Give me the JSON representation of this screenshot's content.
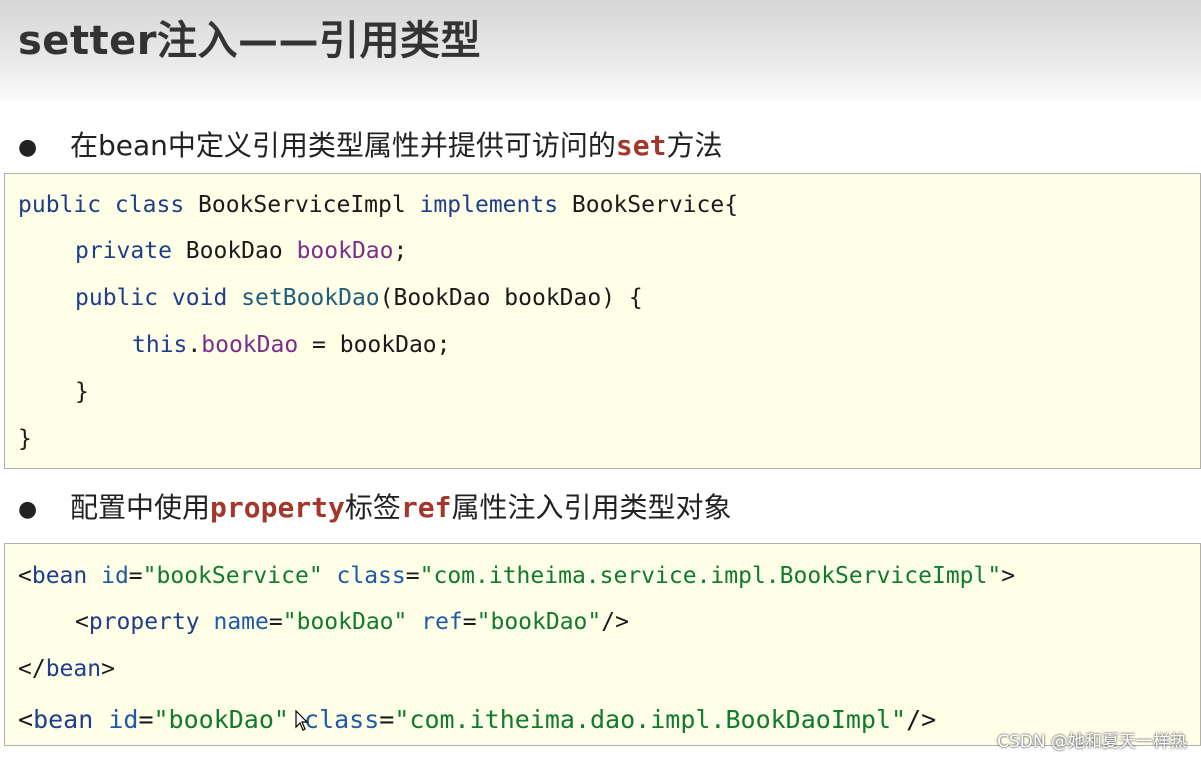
{
  "title": "setter注入——引用类型",
  "bullet1": {
    "prefix": "在bean中定义引用类型属性并提供可访问的",
    "keyword": "set",
    "suffix": "方法"
  },
  "java_code": {
    "line1": {
      "kw1": "public class",
      "t1": " BookServiceImpl ",
      "kw2": "implements",
      "t2": " BookService{"
    },
    "line2": {
      "kw": "private",
      "t1": " BookDao ",
      "field": "bookDao",
      "t2": ";"
    },
    "line3": {
      "kw": "public void",
      "method": "setBookDao",
      "t1": "(BookDao bookDao) {"
    },
    "line4": {
      "kw": "this",
      "t1": ".",
      "field": "bookDao",
      "t2": " = bookDao;"
    },
    "line5": "}",
    "line6": "}"
  },
  "bullet2": {
    "prefix": "配置中使用",
    "keyword1": "property",
    "middle": "标签",
    "keyword2": "ref",
    "suffix": "属性注入引用类型对象"
  },
  "xml_code": {
    "line1": {
      "open": "<",
      "tag": "bean",
      "a1": " id",
      "eq1": "=",
      "v1": "\"bookService\"",
      "a2": " class",
      "eq2": "=",
      "v2": "\"com.itheima.service.impl.BookServiceImpl\"",
      "close": ">"
    },
    "line2": {
      "open": "<",
      "tag": "property",
      "a1": " name",
      "eq1": "=",
      "v1": "\"bookDao\"",
      "a2": " ref",
      "eq2": "=",
      "v2": "\"bookDao\"",
      "close": "/>"
    },
    "line3": {
      "open": "</",
      "tag": "bean",
      "close": ">"
    },
    "line4": {
      "open": "<",
      "tag": "bean",
      "a1": " id",
      "eq1": "=",
      "v1": "\"bookDao\"",
      "a2": " class",
      "eq2": "=",
      "v2": "\"com.itheima.dao.impl.BookDaoImpl\"",
      "close": "/>"
    }
  },
  "watermark": "CSDN @她和夏天一样热",
  "icons": {
    "bullet": "bullet-dot-icon",
    "cursor": "mouse-cursor-icon"
  }
}
